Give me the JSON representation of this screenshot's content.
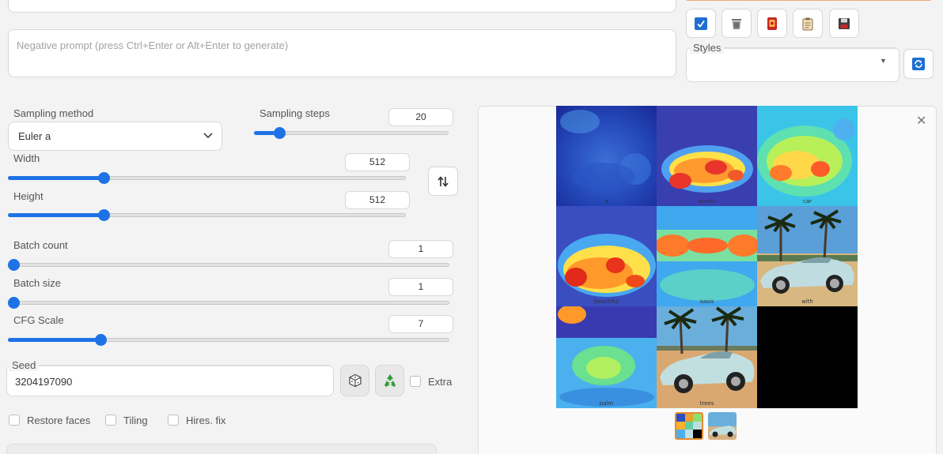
{
  "prompt": {
    "negative_placeholder": "Negative prompt (press Ctrl+Enter or Alt+Enter to generate)"
  },
  "toolbar": {
    "icons": [
      "check-icon",
      "trash-icon",
      "hypernetwork-icon",
      "clipboard-icon",
      "save-icon"
    ],
    "accent_color": "#f2a67a"
  },
  "styles": {
    "label": "Styles",
    "value": ""
  },
  "sampling": {
    "method_label": "Sampling method",
    "method_value": "Euler a",
    "steps_label": "Sampling steps",
    "steps_value": "20",
    "steps_fraction": 0.13
  },
  "size": {
    "width_label": "Width",
    "width_value": "512",
    "width_fraction": 0.24,
    "height_label": "Height",
    "height_value": "512",
    "height_fraction": 0.24
  },
  "batch": {
    "count_label": "Batch count",
    "count_value": "1",
    "count_fraction": 0.0,
    "size_label": "Batch size",
    "size_value": "1",
    "size_fraction": 0.0
  },
  "cfg": {
    "label": "CFG Scale",
    "value": "7",
    "fraction": 0.21
  },
  "seed": {
    "label": "Seed",
    "value": "3204197090",
    "extra_label": "Extra"
  },
  "options": {
    "restore_faces": "Restore faces",
    "tiling": "Tiling",
    "hires_fix": "Hires. fix"
  },
  "gallery": {
    "captions": [
      "a",
      "sports",
      "car",
      "beautiful",
      "oasis",
      "with",
      "palm",
      "trees",
      ""
    ]
  },
  "colors": {
    "accent_blue": "#1e72e6"
  }
}
